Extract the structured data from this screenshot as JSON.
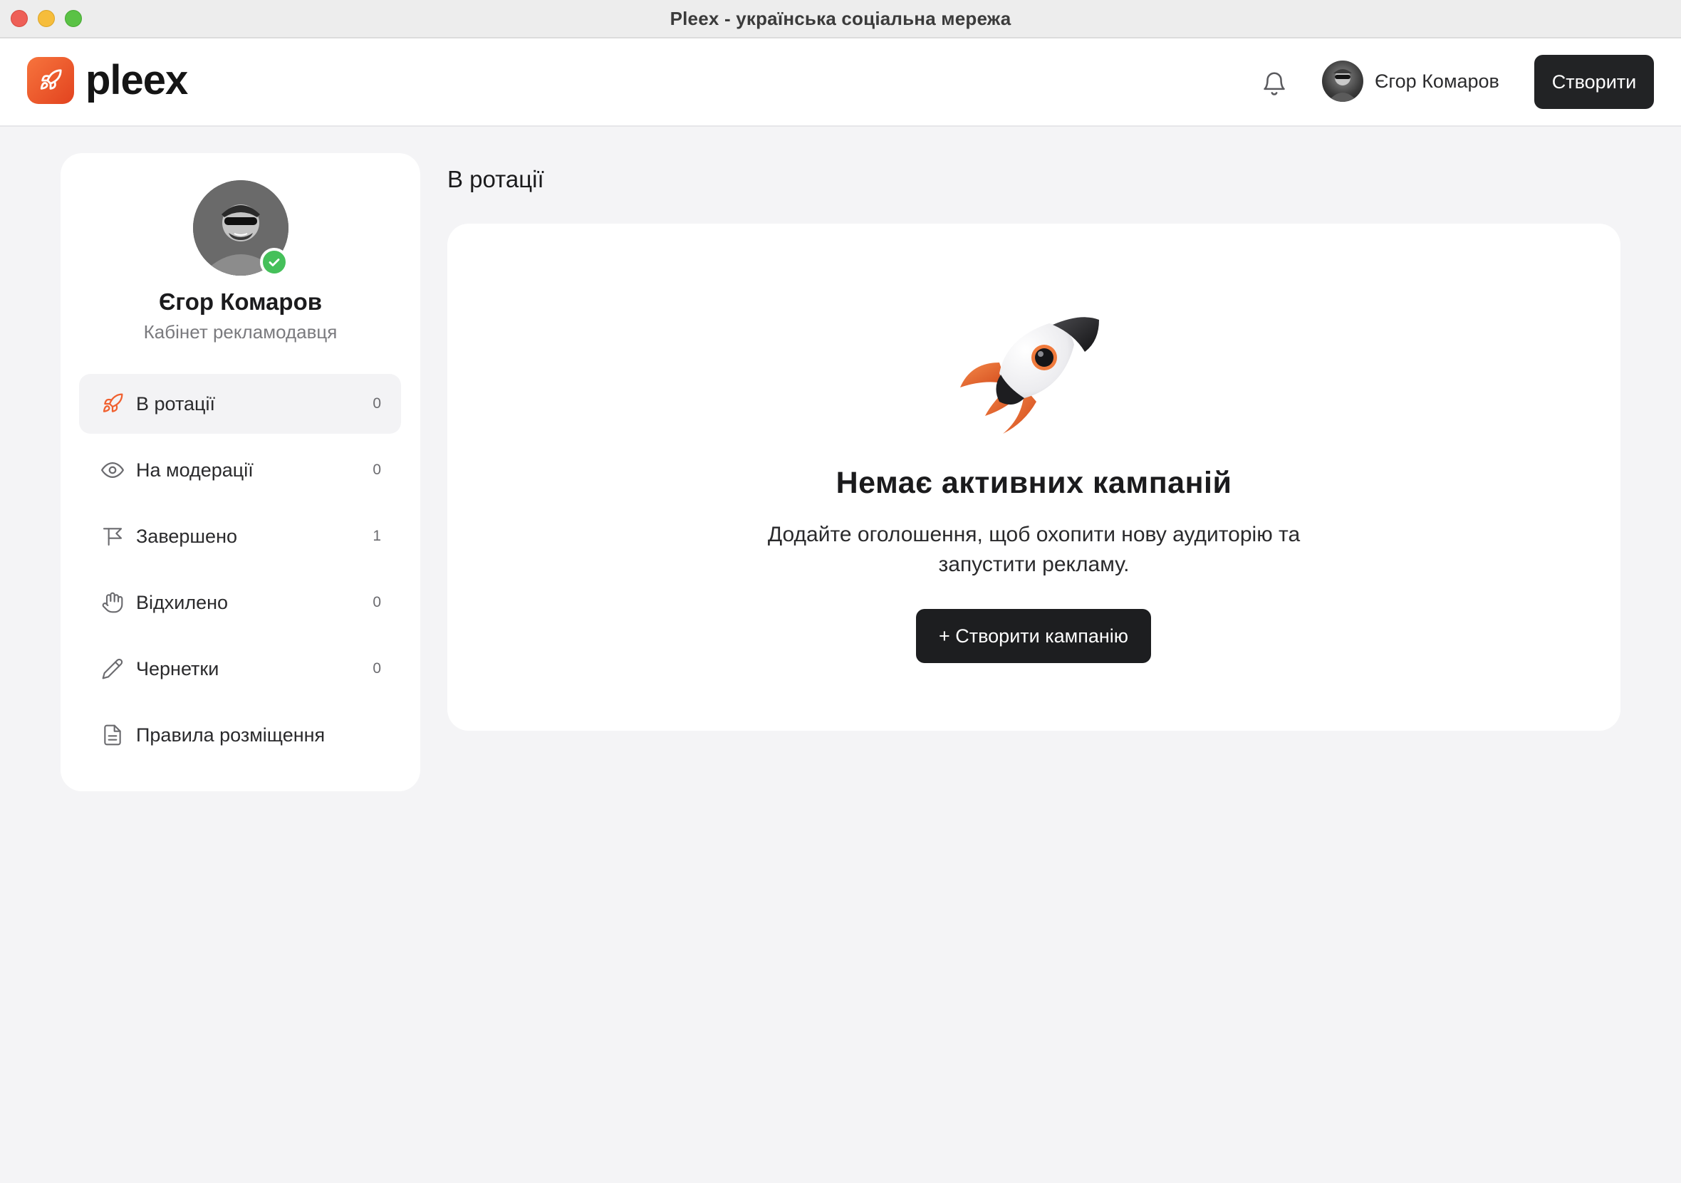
{
  "window": {
    "title": "Pleex - українська соціальна мережа"
  },
  "header": {
    "logo_text": "pleex",
    "user_name": "Єгор Комаров",
    "create_label": "Створити"
  },
  "profile": {
    "name": "Єгор Комаров",
    "subtitle": "Кабінет рекламодавця"
  },
  "nav": [
    {
      "label": "В ротації",
      "count": "0",
      "icon": "rocket-icon",
      "active": true
    },
    {
      "label": "На модерації",
      "count": "0",
      "icon": "eye-icon"
    },
    {
      "label": "Завершено",
      "count": "1",
      "icon": "flag-icon"
    },
    {
      "label": "Відхилено",
      "count": "0",
      "icon": "hand-icon"
    },
    {
      "label": "Чернетки",
      "count": "0",
      "icon": "pencil-icon"
    },
    {
      "label": "Правила розміщення",
      "count": "",
      "icon": "document-icon"
    }
  ],
  "main": {
    "section_title": "В ротації",
    "empty_title": "Немає активних кампаній",
    "empty_description": "Додайте оголошення, щоб охопити нову аудиторію та запустити рекламу.",
    "create_campaign_label": "+ Створити кампанію"
  },
  "colors": {
    "accent": "#f0602f",
    "dark_button": "#222325",
    "verified": "#45c05a",
    "background": "#f4f4f6"
  }
}
